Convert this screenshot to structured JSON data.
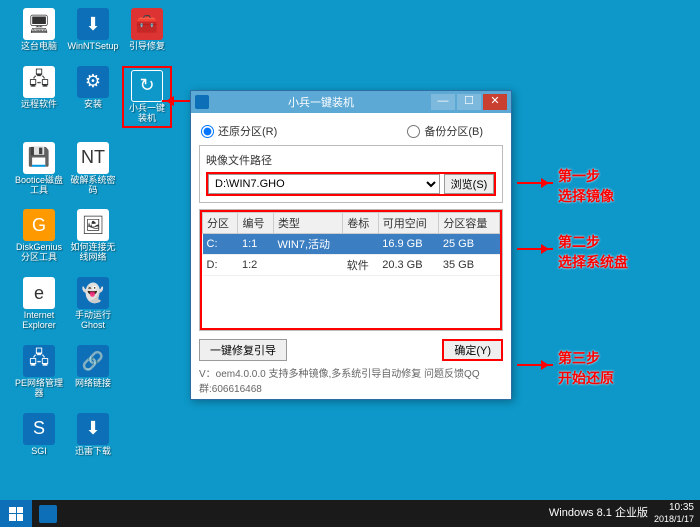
{
  "desktop_icons": [
    {
      "label": "这台电脑",
      "cls": "white",
      "glyph": "🖥"
    },
    {
      "label": "WinNTSetup",
      "cls": "blue",
      "glyph": "⬇"
    },
    {
      "label": "引导修复",
      "cls": "red",
      "glyph": "🧰"
    },
    {
      "label": "远程软件",
      "cls": "white",
      "glyph": "🖧"
    },
    {
      "label": "安装",
      "cls": "blue",
      "glyph": "⚙"
    },
    {
      "label": "小兵一键装机",
      "cls": "teal",
      "glyph": "↻",
      "highlighted": true
    },
    {
      "label": "Bootice磁盘工具",
      "cls": "white",
      "glyph": "💾"
    },
    {
      "label": "破解系统密码",
      "cls": "white",
      "glyph": "NT"
    },
    {
      "label": "",
      "cls": "",
      "glyph": ""
    },
    {
      "label": "DiskGenius分区工具",
      "cls": "orange",
      "glyph": "G"
    },
    {
      "label": "如何连接无线网络",
      "cls": "white",
      "glyph": "🖼"
    },
    {
      "label": "",
      "cls": "",
      "glyph": ""
    },
    {
      "label": "Internet Explorer",
      "cls": "white",
      "glyph": "e"
    },
    {
      "label": "手动运行Ghost",
      "cls": "blue",
      "glyph": "👻"
    },
    {
      "label": "",
      "cls": "",
      "glyph": ""
    },
    {
      "label": "PE网络管理器",
      "cls": "blue",
      "glyph": "🖧"
    },
    {
      "label": "网络链接",
      "cls": "blue",
      "glyph": "🔗"
    },
    {
      "label": "",
      "cls": "",
      "glyph": ""
    },
    {
      "label": "SGI",
      "cls": "blue",
      "glyph": "S"
    },
    {
      "label": "迅雷下载",
      "cls": "blue",
      "glyph": "⬇"
    }
  ],
  "window": {
    "title": "小兵一键装机",
    "restore_radio": "还原分区(R)",
    "backup_radio": "备份分区(B)",
    "path_label": "映像文件路径",
    "path_value": "D:\\WIN7.GHO",
    "browse_btn": "浏览(S)",
    "columns": [
      "分区",
      "编号",
      "类型",
      "卷标",
      "可用空间",
      "分区容量"
    ],
    "rows": [
      {
        "drive": "C:",
        "id": "1:1",
        "type": "WIN7,活动",
        "vol": "",
        "free": "16.9 GB",
        "size": "25 GB",
        "selected": true
      },
      {
        "drive": "D:",
        "id": "1:2",
        "type": "",
        "vol": "软件",
        "free": "20.3 GB",
        "size": "35 GB",
        "selected": false
      }
    ],
    "repair_btn": "一键修复引导",
    "ok_btn": "确定(Y)",
    "footer": "V：oem4.0.0.0        支持多种镜像,多系统引导自动修复 问题反馈QQ群:606616468"
  },
  "annotations": {
    "step1_title": "第一步",
    "step1_sub": "选择镜像",
    "step2_title": "第二步",
    "step2_sub": "选择系统盘",
    "step3_title": "第三步",
    "step3_sub": "开始还原"
  },
  "taskbar": {
    "os": "Windows 8.1 企业版",
    "time": "10:35",
    "date": "2018/1/17"
  }
}
